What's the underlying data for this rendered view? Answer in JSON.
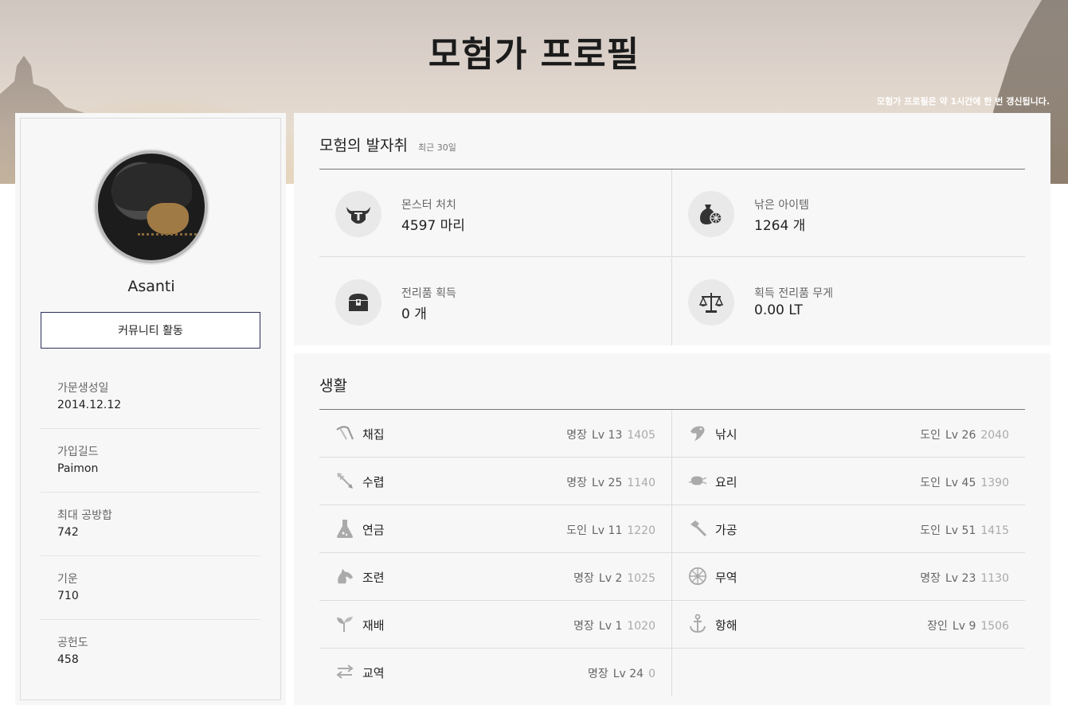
{
  "header": {
    "title": "모험가 프로필",
    "update_note": "모험가 프로필은 약 1시간에 한 번 갱신됩니다."
  },
  "profile": {
    "name": "Asanti",
    "community_button": "커뮤니티 활동",
    "info": [
      {
        "label": "가문생성일",
        "value": "2014.12.12"
      },
      {
        "label": "가입길드",
        "value": "Paimon"
      },
      {
        "label": "최대 공방합",
        "value": "742"
      },
      {
        "label": "기운",
        "value": "710"
      },
      {
        "label": "공헌도",
        "value": "458"
      }
    ]
  },
  "adventure": {
    "title": "모험의 발자취",
    "subtitle": "최근 30일",
    "stats": [
      {
        "label": "몬스터 처치",
        "value": "4597 마리",
        "icon": "monster-icon"
      },
      {
        "label": "낚은 아이템",
        "value": "1264 개",
        "icon": "fishing-bag-icon"
      },
      {
        "label": "전리품 획득",
        "value": "0 개",
        "icon": "treasure-chest-icon"
      },
      {
        "label": "획득 전리품 무게",
        "value": "0.00 LT",
        "icon": "scale-icon"
      }
    ]
  },
  "life": {
    "title": "생활",
    "skills": [
      {
        "name": "채집",
        "rank": "명장",
        "level": "Lv 13",
        "exp": "1405",
        "icon": "gathering-icon"
      },
      {
        "name": "낚시",
        "rank": "도인",
        "level": "Lv 26",
        "exp": "2040",
        "icon": "fishing-icon"
      },
      {
        "name": "수렵",
        "rank": "명장",
        "level": "Lv 25",
        "exp": "1140",
        "icon": "hunting-icon"
      },
      {
        "name": "요리",
        "rank": "도인",
        "level": "Lv 45",
        "exp": "1390",
        "icon": "cooking-icon"
      },
      {
        "name": "연금",
        "rank": "도인",
        "level": "Lv 11",
        "exp": "1220",
        "icon": "alchemy-icon"
      },
      {
        "name": "가공",
        "rank": "도인",
        "level": "Lv 51",
        "exp": "1415",
        "icon": "processing-icon"
      },
      {
        "name": "조련",
        "rank": "명장",
        "level": "Lv 2",
        "exp": "1025",
        "icon": "training-icon"
      },
      {
        "name": "무역",
        "rank": "명장",
        "level": "Lv 23",
        "exp": "1130",
        "icon": "trade-wheel-icon"
      },
      {
        "name": "재배",
        "rank": "명장",
        "level": "Lv 1",
        "exp": "1020",
        "icon": "farming-icon"
      },
      {
        "name": "항해",
        "rank": "장인",
        "level": "Lv 9",
        "exp": "1506",
        "icon": "sailing-icon"
      },
      {
        "name": "교역",
        "rank": "명장",
        "level": "Lv 24",
        "exp": "0",
        "icon": "barter-icon"
      }
    ]
  },
  "colors": {
    "button_border": "#2d2f5e",
    "icon_gray": "#555555",
    "icon_light": "#bbbbbb"
  }
}
